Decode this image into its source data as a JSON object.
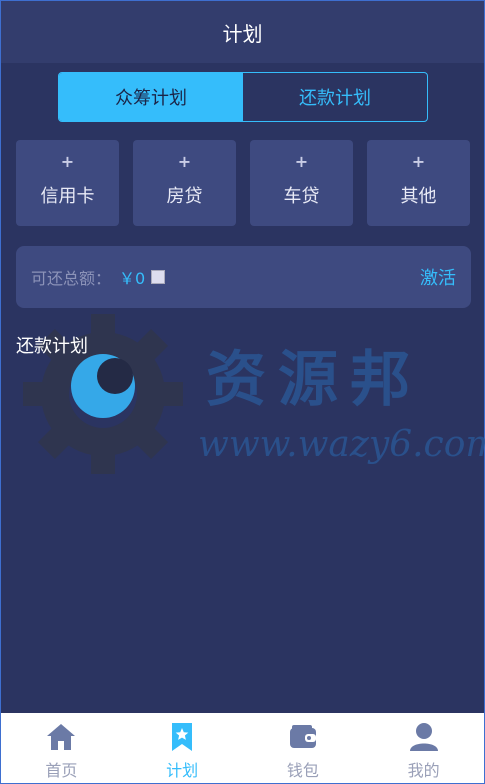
{
  "header": {
    "title": "计划"
  },
  "segment": {
    "crowdfund": "众筹计划",
    "repay": "还款计划"
  },
  "categories": [
    {
      "plus": "+",
      "label": "信用卡"
    },
    {
      "plus": "+",
      "label": "房贷"
    },
    {
      "plus": "+",
      "label": "车贷"
    },
    {
      "plus": "+",
      "label": "其他"
    }
  ],
  "repay_box": {
    "label": "可还总额：",
    "amount": "￥0",
    "activate": "激活"
  },
  "section": {
    "title": "还款计划"
  },
  "watermark": {
    "name": "资源邦",
    "url": "www.wazy6.com"
  },
  "tabs": [
    {
      "label": "首页",
      "icon": "home-icon"
    },
    {
      "label": "计划",
      "icon": "bookmark-star-icon"
    },
    {
      "label": "钱包",
      "icon": "wallet-icon"
    },
    {
      "label": "我的",
      "icon": "user-icon"
    }
  ],
  "colors": {
    "accent": "#35bdfb",
    "bg": "#2b3461",
    "card": "#3e4a80"
  }
}
